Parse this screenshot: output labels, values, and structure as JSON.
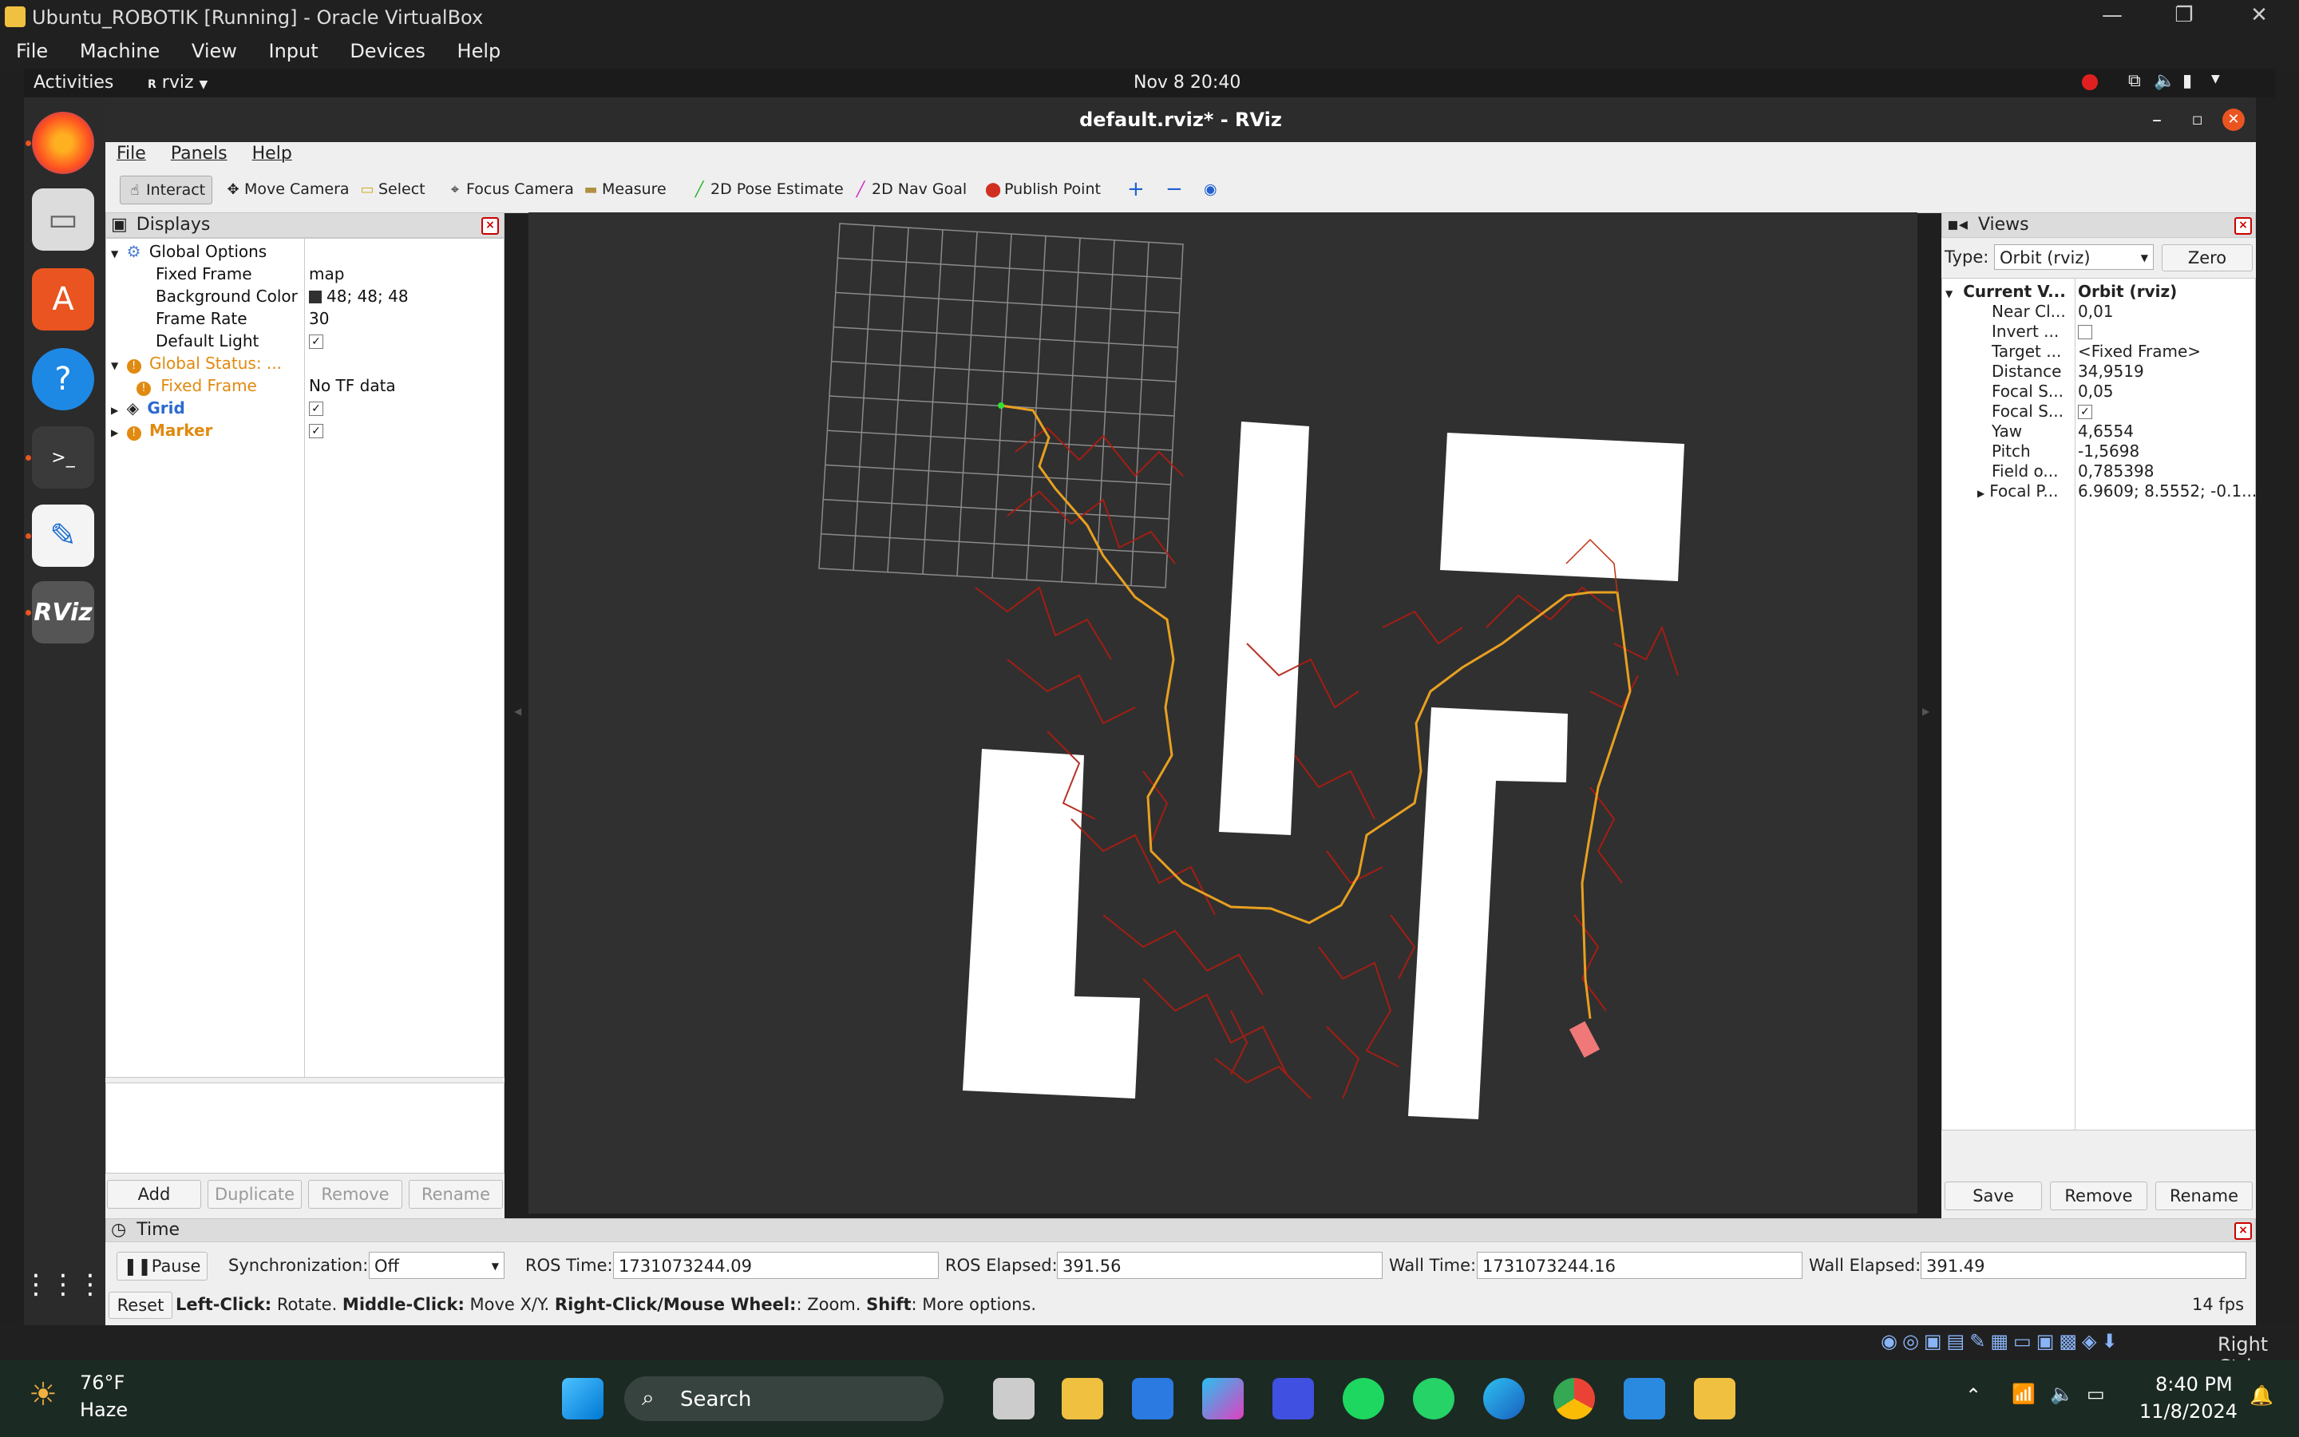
{
  "vbox": {
    "title": "Ubuntu_ROBOTIK [Running] - Oracle VirtualBox",
    "menu": [
      "File",
      "Machine",
      "View",
      "Input",
      "Devices",
      "Help"
    ],
    "host_key": "Right Ctrl"
  },
  "gnome": {
    "activities": "Activities",
    "app_name": "rviz",
    "clock": "Nov 8  20:40"
  },
  "rviz": {
    "title": "default.rviz* - RViz",
    "menu": [
      "File",
      "Panels",
      "Help"
    ],
    "tools": [
      "Interact",
      "Move Camera",
      "Select",
      "Focus Camera",
      "Measure",
      "2D Pose Estimate",
      "2D Nav Goal",
      "Publish Point"
    ],
    "displays": {
      "title": "Displays",
      "global_options": "Global Options",
      "fixed_frame_label": "Fixed Frame",
      "fixed_frame_value": "map",
      "bg_label": "Background Color",
      "bg_value": "48; 48; 48",
      "frame_rate_label": "Frame Rate",
      "frame_rate_value": "30",
      "default_light_label": "Default Light",
      "global_status": "Global Status: ...",
      "status_fixed_frame": "Fixed Frame",
      "status_value": "No TF data",
      "grid": "Grid",
      "marker": "Marker",
      "buttons": [
        "Add",
        "Duplicate",
        "Remove",
        "Rename"
      ]
    },
    "views": {
      "title": "Views",
      "type_label": "Type:",
      "type_value": "Orbit (rviz)",
      "zero": "Zero",
      "rows": [
        {
          "k": "Current V...",
          "v": "Orbit (rviz)"
        },
        {
          "k": "Near Cl...",
          "v": "0,01"
        },
        {
          "k": "Invert ...",
          "v": ""
        },
        {
          "k": "Target ...",
          "v": "<Fixed Frame>"
        },
        {
          "k": "Distance",
          "v": "34,9519"
        },
        {
          "k": "Focal S...",
          "v": "0,05"
        },
        {
          "k": "Focal S...",
          "v": ""
        },
        {
          "k": "Yaw",
          "v": "4,6554"
        },
        {
          "k": "Pitch",
          "v": "-1,5698"
        },
        {
          "k": "Field o...",
          "v": "0,785398"
        },
        {
          "k": "Focal P...",
          "v": "6.9609; 8.5552; -0.1..."
        }
      ],
      "buttons": [
        "Save",
        "Remove",
        "Rename"
      ]
    },
    "time": {
      "title": "Time",
      "pause": "Pause",
      "sync_label": "Synchronization:",
      "sync_value": "Off",
      "ros_time_label": "ROS Time:",
      "ros_time": "1731073244.09",
      "ros_elapsed_label": "ROS Elapsed:",
      "ros_elapsed": "391.56",
      "wall_time_label": "Wall Time:",
      "wall_time": "1731073244.16",
      "wall_elapsed_label": "Wall Elapsed:",
      "wall_elapsed": "391.49"
    },
    "status": {
      "reset": "Reset",
      "b1": "Left-Click:",
      "t1": " Rotate. ",
      "b2": "Middle-Click:",
      "t2": " Move X/Y. ",
      "b3": "Right-Click/Mouse Wheel:",
      "t3": ": Zoom. ",
      "b4": "Shift",
      "t4": ": More options.",
      "fps": "14 fps"
    }
  },
  "taskbar": {
    "weather_temp": "76°F",
    "weather_desc": "Haze",
    "search": "Search",
    "time": "8:40 PM",
    "date": "11/8/2024"
  },
  "colors": {
    "rviz_bg": "#303030",
    "path_red": "#b01c10",
    "path_orange": "#e8a020",
    "robot": "#f07878",
    "warn": "#e08a10"
  }
}
